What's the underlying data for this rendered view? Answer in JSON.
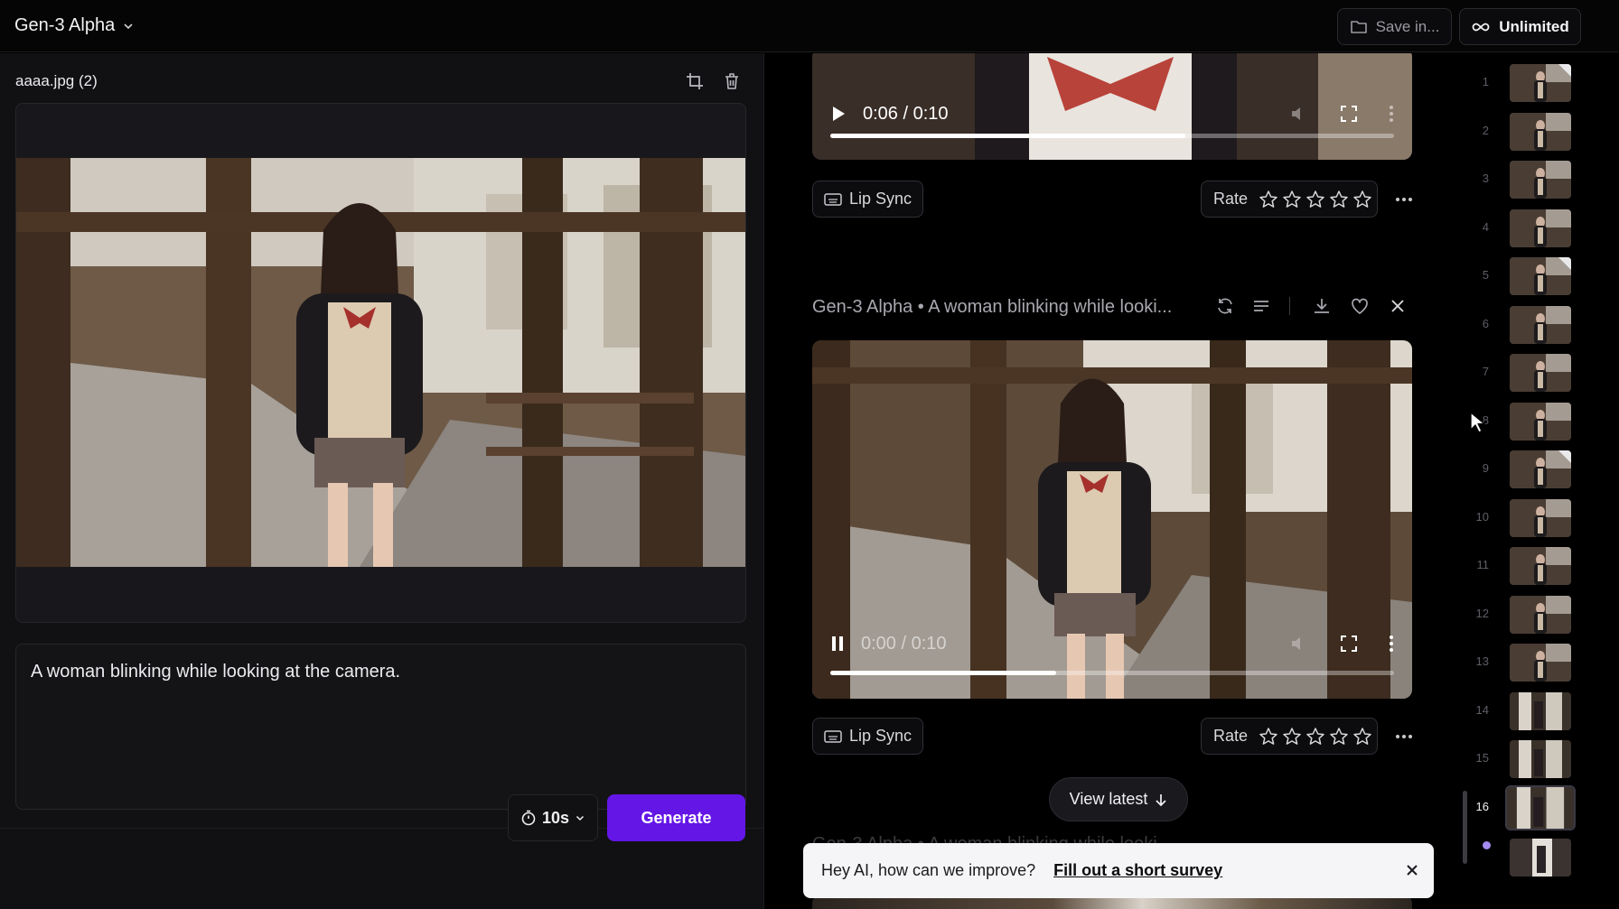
{
  "topbar": {
    "model": "Gen-3 Alpha",
    "save_label": "Save in...",
    "plan_label": "Unlimited"
  },
  "left": {
    "file_name": "aaaa.jpg (2)",
    "prompt": "A woman blinking while looking at the camera.",
    "duration": "10s",
    "generate_label": "Generate"
  },
  "feed": {
    "video1": {
      "time": "0:06 / 0:10",
      "progress": 0.63
    },
    "actions": {
      "lipsync_label": "Lip Sync",
      "rate_label": "Rate"
    },
    "gen2": {
      "title": "Gen-3 Alpha • A woman blinking while looki...",
      "video": {
        "time": "0:00 / 0:10",
        "progress": 0.4
      }
    },
    "gen3": {
      "title": "Gen-3 Alpha • A woman blinking while looki..."
    },
    "view_latest_label": "View latest",
    "survey": {
      "text": "Hey AI, how can we improve?",
      "link": "Fill out a short survey"
    }
  },
  "rail": {
    "items": [
      "1",
      "2",
      "3",
      "4",
      "5",
      "6",
      "7",
      "8",
      "9",
      "10",
      "11",
      "12",
      "13",
      "14",
      "15",
      "16"
    ],
    "active": "16"
  },
  "colors": {
    "accent": "#6316e6",
    "dot": "#a58cf0"
  }
}
